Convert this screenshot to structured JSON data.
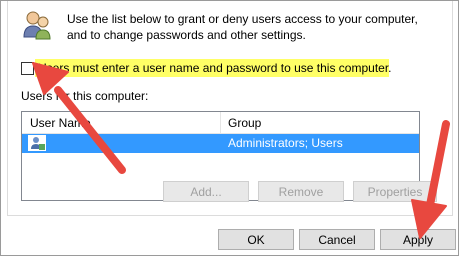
{
  "description": {
    "line1": "Use the list below to grant or deny users access to your computer,",
    "line2": "and to change passwords and other settings."
  },
  "checkbox": {
    "label": "Users must enter a user name and password to use this computer.",
    "checked": false
  },
  "users_list": {
    "label": "Users for this computer:",
    "columns": [
      "User Name",
      "Group"
    ],
    "rows": [
      {
        "user_name": "",
        "group": "Administrators; Users",
        "selected": true
      }
    ]
  },
  "buttons": {
    "add": "Add...",
    "remove": "Remove",
    "properties": "Properties",
    "ok": "OK",
    "cancel": "Cancel",
    "apply": "Apply"
  },
  "colors": {
    "highlight": "#ffff66",
    "selection": "#3399ff",
    "arrow": "#e8483f"
  }
}
